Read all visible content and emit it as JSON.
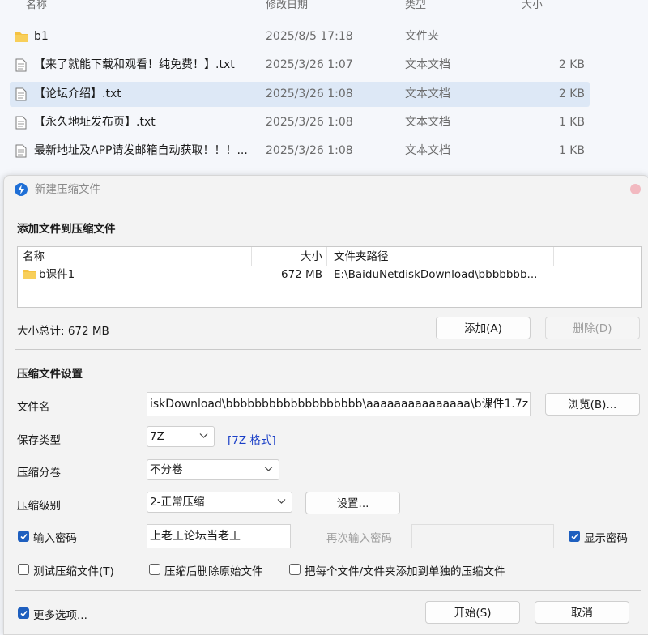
{
  "explorer": {
    "columns": {
      "name": "名称",
      "date": "修改日期",
      "type": "类型",
      "size": "大小"
    },
    "rows": [
      {
        "name": "b1",
        "date": "2025/8/5 17:18",
        "type": "文件夹",
        "size": "",
        "icon": "folder-icon"
      },
      {
        "name": "【来了就能下载和观看！纯免费！】.txt",
        "date": "2025/3/26 1:07",
        "type": "文本文档",
        "size": "2 KB",
        "icon": "text-file-icon"
      },
      {
        "name": "【论坛介绍】.txt",
        "date": "2025/3/26 1:08",
        "type": "文本文档",
        "size": "2 KB",
        "icon": "text-file-icon",
        "selected": true
      },
      {
        "name": "【永久地址发布页】.txt",
        "date": "2025/3/26 1:08",
        "type": "文本文档",
        "size": "1 KB",
        "icon": "text-file-icon"
      },
      {
        "name": "最新地址及APP请发邮箱自动获取！！！...",
        "date": "2025/3/26 1:08",
        "type": "文本文档",
        "size": "1 KB",
        "icon": "text-file-icon"
      }
    ]
  },
  "dialog": {
    "title": "新建压缩文件",
    "add_section_title": "添加文件到压缩文件",
    "list": {
      "headers": {
        "name": "名称",
        "size": "大小",
        "path": "文件夹路径"
      },
      "rows": [
        {
          "name": "b课件1",
          "size": "672 MB",
          "path": "E:\\BaiduNetdiskDownload\\bbbbbbb...",
          "icon": "folder-icon"
        }
      ]
    },
    "total_size": "大小总计: 672 MB",
    "add_button": "添加(A)",
    "delete_button": "删除(D)",
    "settings_section_title": "压缩文件设置",
    "filename_label": "文件名",
    "filename_value": "iskDownload\\bbbbbbbbbbbbbbbbbbb\\aaaaaaaaaaaaaaa\\b课件1.7z",
    "browse_button": "浏览(B)...",
    "save_type_label": "保存类型",
    "save_type_value": "7Z",
    "format_link": "[7Z 格式]",
    "split_label": "压缩分卷",
    "split_value": "不分卷",
    "level_label": "压缩级别",
    "level_value": "2-正常压缩",
    "settings_button": "设置...",
    "password_checkbox": {
      "label": "输入密码",
      "checked": true
    },
    "password_value": "上老王论坛当老王",
    "reenter_password_label": "再次输入密码",
    "reenter_password_value": "",
    "show_password_checkbox": {
      "label": "显示密码",
      "checked": true
    },
    "test_checkbox": {
      "label": "测试压缩文件(T)",
      "checked": false
    },
    "delete_after_checkbox": {
      "label": "压缩后删除原始文件",
      "checked": false
    },
    "separate_checkbox": {
      "label": "把每个文件/文件夹添加到单独的压缩文件",
      "checked": false
    },
    "more_options_checkbox": {
      "label": "更多选项...",
      "checked": true
    },
    "start_button": "开始(S)",
    "cancel_button": "取消"
  },
  "colors": {
    "accent": "#1e5fbf",
    "link": "#1a3fc7",
    "selected_row": "#dde8f6",
    "folder": "#f5c242"
  }
}
